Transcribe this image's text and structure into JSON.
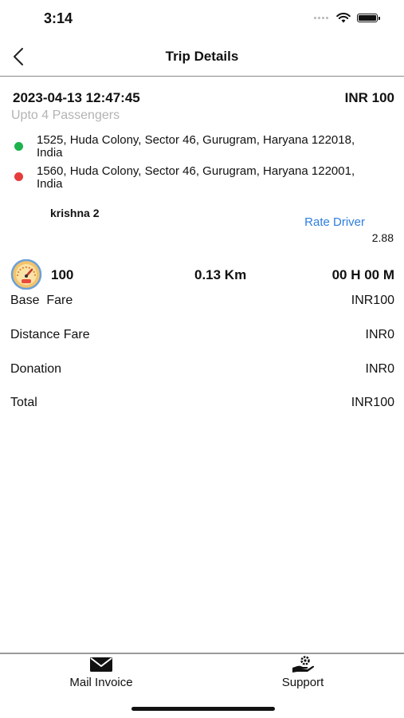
{
  "status_bar": {
    "time": "3:14"
  },
  "nav": {
    "title": "Trip Details"
  },
  "trip": {
    "datetime": "2023-04-13 12:47:45",
    "fare": "INR 100",
    "passengers": "Upto 4 Passengers",
    "pickup_address": "1525, Huda Colony, Sector 46, Gurugram, Haryana 122018, India",
    "drop_address": "1560, Huda Colony, Sector 46, Gurugram, Haryana 122001, India"
  },
  "driver": {
    "name": "krishna 2",
    "rate_label": "Rate Driver",
    "rating": "2.88"
  },
  "stats": {
    "amount": "100",
    "distance": "0.13 Km",
    "duration": "00 H 00 M"
  },
  "fare_breakdown": [
    {
      "label": "Base  Fare",
      "value": "INR100"
    },
    {
      "label": "Distance Fare",
      "value": "INR0"
    },
    {
      "label": "Donation",
      "value": "INR0"
    },
    {
      "label": "Total",
      "value": "INR100"
    }
  ],
  "tab_bar": {
    "mail_label": "Mail Invoice",
    "support_label": "Support"
  },
  "colors": {
    "pickup_dot": "#1db24d",
    "drop_dot": "#e63c3c",
    "link": "#2f7de0",
    "muted_text": "#b3b3b3"
  },
  "icons": {
    "back": "chevron-left-icon",
    "meter": "speedometer-icon",
    "mail": "envelope-icon",
    "support": "hand-gear-icon"
  }
}
